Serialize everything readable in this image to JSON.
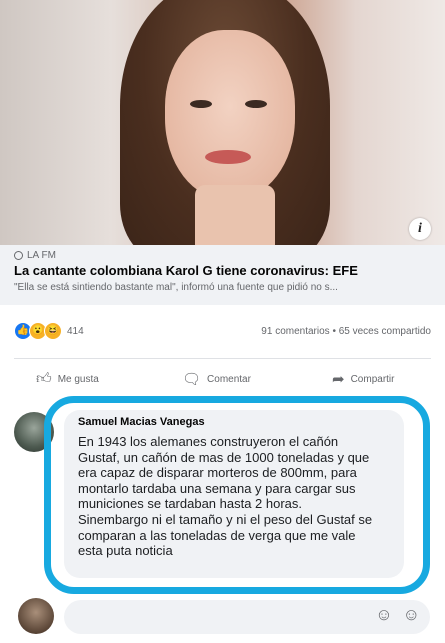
{
  "post": {
    "info_label": "i",
    "link": {
      "source": "LA FM",
      "headline": "La cantante colombiana Karol G tiene coronavirus: EFE",
      "snippet": "\"Ella se está sintiendo bastante mal\", informó una fuente que pidió no s..."
    },
    "reactions": {
      "count": "414",
      "types": [
        "like-icon",
        "wow-icon",
        "haha-icon"
      ]
    },
    "stats": "91 comentarios • 65 veces compartido",
    "actions": {
      "like": "Me gusta",
      "comment": "Comentar",
      "share": "Compartir"
    }
  },
  "comment": {
    "author": "Samuel Macias Vanegas",
    "text": "En 1943 los alemanes construyeron el cañón\nGustaf, un cañón de mas de 1000 toneladas y que\nera capaz de disparar morteros  de 800mm, para\nmontarlo tardaba una semana y para cargar sus\nmuniciones se tardaban hasta 2 horas.\nSinembargo ni el tamaño y ni el peso del Gustaf se\ncomparan a  las toneladas de verga que me vale\nesta puta noticia"
  },
  "reply": {
    "placeholder": "",
    "icons": [
      "sticker-icon",
      "emoji-icon"
    ]
  },
  "colors": {
    "highlight_border": "#17a9e0",
    "link_background": "#f0f2f5",
    "like_blue": "#1877f2"
  }
}
